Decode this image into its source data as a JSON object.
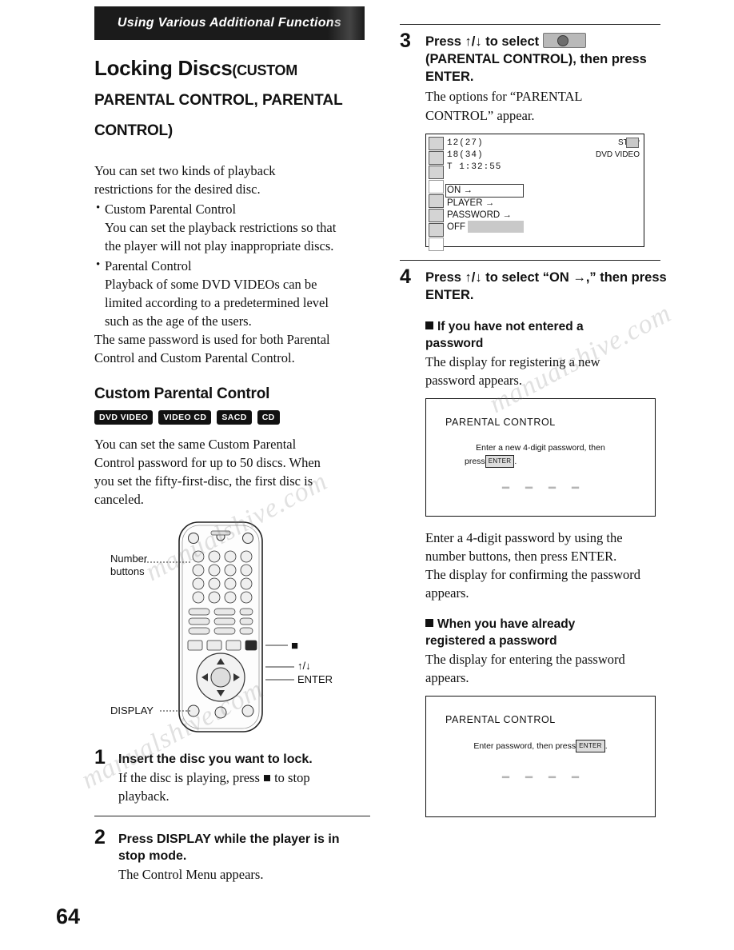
{
  "page_number": "64",
  "left": {
    "banner": "Using Various Additional Functions",
    "heading_main": "Locking Discs",
    "heading_paren_open": "(CUSTOM",
    "heading_line2": "PARENTAL CONTROL, PARENTAL",
    "heading_line3": "CONTROL)",
    "intro_1": "You can set two kinds of playback",
    "intro_2": "restrictions for the desired disc.",
    "bullet1_title": "Custom Parental Control",
    "bullet1_body_1": "You can set the playback restrictions so that",
    "bullet1_body_2": "the player will not play inappropriate discs.",
    "bullet2_title": "Parental Control",
    "bullet2_body_1": "Playback of some DVD VIDEOs can be",
    "bullet2_body_2": "limited according to a predetermined level",
    "bullet2_body_3": "such as the age of the users.",
    "intro_3": "The same password is used for both Parental",
    "intro_4": "Control and Custom Parental Control.",
    "section_heading": "Custom Parental Control",
    "tags": [
      "DVD VIDEO",
      "VIDEO CD",
      "SACD",
      "CD"
    ],
    "para_1": "You can set the same Custom Parental",
    "para_2": "Control password for up to 50 discs. When",
    "para_3": "you set the fifty-first-disc, the first disc is",
    "para_4": "canceled.",
    "callouts": {
      "number_buttons_l1": "Number",
      "number_buttons_l2": "buttons",
      "stop": "■",
      "updown": "↑/↓",
      "enter": "ENTER",
      "display": "DISPLAY"
    },
    "steps": [
      {
        "num": "1",
        "title": "Insert the disc you want to lock.",
        "body_1": "If the disc is playing, press ■ to stop",
        "body_2": "playback."
      },
      {
        "num": "2",
        "title_1": "Press DISPLAY while the player is in",
        "title_2": "stop mode.",
        "body_1": "The Control Menu appears."
      }
    ]
  },
  "right": {
    "step3": {
      "num": "3",
      "title_1": "Press ↑/↓ to select",
      "title_2": "(PARENTAL CONTROL), then press",
      "title_3": "ENTER.",
      "body_1": "The options for “PARENTAL",
      "body_2": "CONTROL” appear."
    },
    "osd": {
      "line1": "12(27)",
      "line2": "18(34)",
      "line3": "T  1:32:55",
      "status": "STOP",
      "disc_type": "DVD VIDEO",
      "options": [
        "ON →",
        "PLAYER →",
        "PASSWORD →",
        "OFF"
      ]
    },
    "step4": {
      "num": "4",
      "title_1": "Press ↑/↓ to select “ON →,” then press",
      "title_2": "ENTER."
    },
    "sub1_line1": "If you have not entered a",
    "sub1_line2": "password",
    "sub1_body_1": "The display for registering a new",
    "sub1_body_2": "password appears.",
    "pcbox1": {
      "title": "PARENTAL CONTROL",
      "line1": "Enter a new 4-digit password, then",
      "line2_pre": "press",
      "line2_btn": "ENTER",
      "line2_post": "."
    },
    "mid_1": "Enter a 4-digit password by using the",
    "mid_2": "number buttons, then press ENTER.",
    "mid_3": "The display for confirming the password",
    "mid_4": "appears.",
    "sub2_line1": "When you have already",
    "sub2_line2": "registered a password",
    "sub2_body_1": "The display for entering the password",
    "sub2_body_2": "appears.",
    "pcbox2": {
      "title": "PARENTAL CONTROL",
      "line1_pre": "Enter password, then press",
      "line1_btn": "ENTER",
      "line1_post": "."
    }
  },
  "watermark": {
    "w1": "manualshive.com",
    "w2": "manualshive.com",
    "w3": "manualshive.com"
  }
}
